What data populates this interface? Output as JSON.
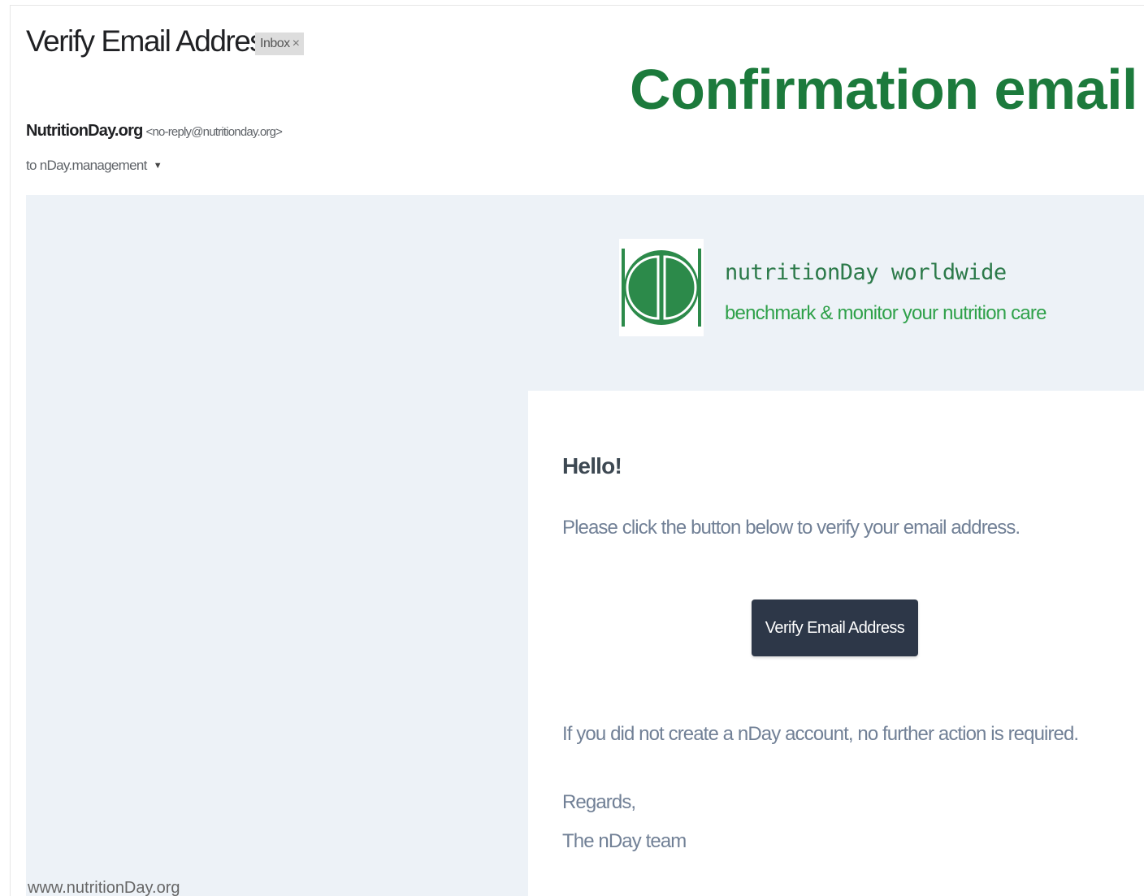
{
  "email": {
    "subject": "Verify Email Address",
    "label_chip": "Inbox",
    "label_chip_close": "×",
    "sender_name": "NutritionDay.org",
    "sender_email": "<no-reply@nutritionday.org>",
    "recipient": "to nDay.management",
    "recipient_caret": "▼"
  },
  "slide": {
    "title": "Confirmation email",
    "footer_url": "www.nutritionDay.org"
  },
  "brand": {
    "logo_icon": "nutritionday-logo-icon",
    "name": "nutritionDay worldwide",
    "tagline": "benchmark & monitor your nutrition care",
    "logo_color": "#2c8a4a",
    "tagline_color": "#2fa14a"
  },
  "message": {
    "greeting": "Hello!",
    "intro": "Please click the button below to verify your email address.",
    "button_label": "Verify Email Address",
    "note": "If you did not create a nDay account, no further action is required.",
    "closing": "Regards,",
    "signature": "The nDay team"
  },
  "colors": {
    "accent_green": "#1c7a3c",
    "button_bg": "#2d3748",
    "body_bg": "#edf2f7"
  }
}
